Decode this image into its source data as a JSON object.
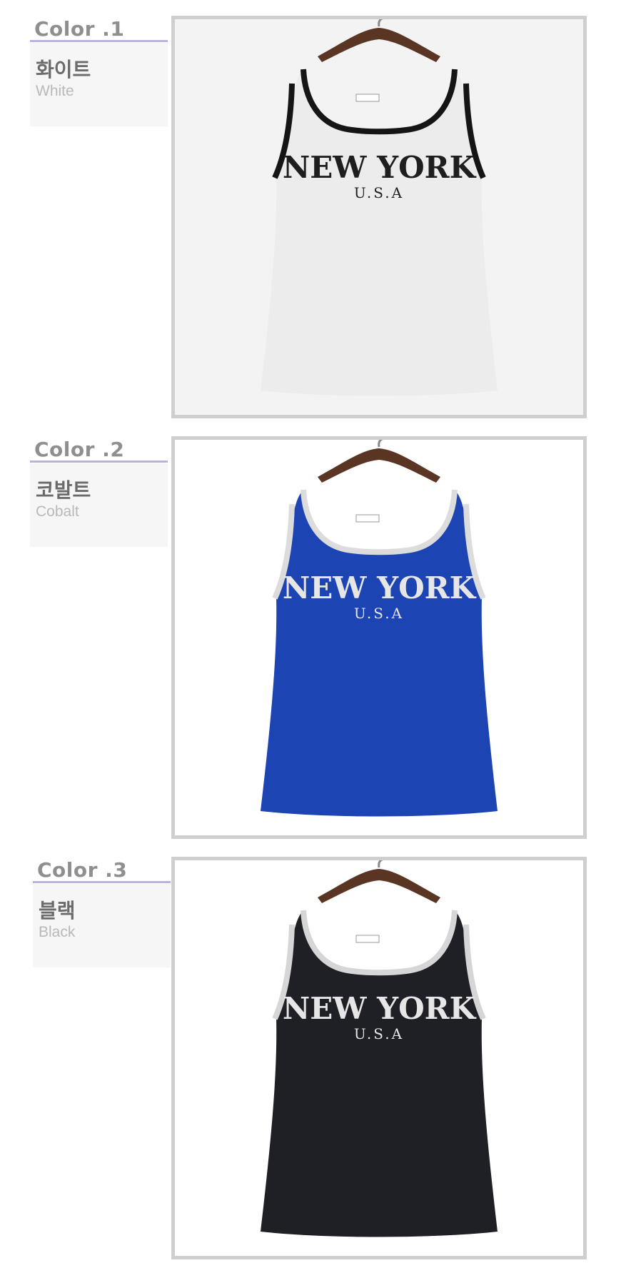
{
  "colors": [
    {
      "title": "Color .1",
      "name_ko": "화이트",
      "name_en": "White",
      "shirt_color": "#ececec",
      "trim_color": "#151515",
      "print_color": "#1e1e1e",
      "photo_bg": "#f3f3f3",
      "print_main": "NEW YORK",
      "print_sub": "U.S.A"
    },
    {
      "title": "Color .2",
      "name_ko": "코발트",
      "name_en": "Cobalt",
      "shirt_color": "#1d44b3",
      "trim_color": "#dcdcdc",
      "print_color": "#e6e6e6",
      "photo_bg": "#ffffff",
      "print_main": "NEW YORK",
      "print_sub": "U.S.A"
    },
    {
      "title": "Color .3",
      "name_ko": "블랙",
      "name_en": "Black",
      "shirt_color": "#1f2025",
      "trim_color": "#d6d6d6",
      "print_color": "#e6e6e6",
      "photo_bg": "#ffffff",
      "print_main": "NEW YORK",
      "print_sub": "U.S.A"
    }
  ],
  "accent": {
    "underline": "#b9b3dd",
    "frame_border": "#cfcfcf",
    "label_bg": "#f6f6f6",
    "hanger_wood": "#5a3524"
  }
}
